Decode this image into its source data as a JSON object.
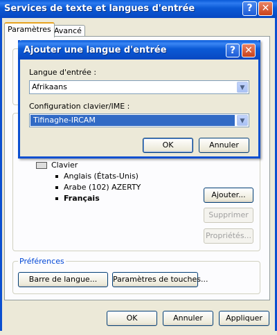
{
  "outer": {
    "title": "Services de texte et langues d'entrée",
    "help_glyph": "?",
    "close_glyph": "✕",
    "tabs": [
      "Paramètres",
      "Avancé"
    ],
    "installed": {
      "keyboard_label": "Clavier",
      "items": [
        "Anglais (États-Unis)",
        "Arabe (102) AZERTY",
        "Français"
      ]
    },
    "buttons": {
      "add": "Ajouter...",
      "remove": "Supprimer",
      "properties": "Propriétés..."
    },
    "preferences": {
      "title": "Préférences",
      "language_bar": "Barre de langue...",
      "key_settings": "Paramètres de touches..."
    },
    "footer": {
      "ok": "OK",
      "cancel": "Annuler",
      "apply": "Appliquer"
    }
  },
  "inner": {
    "title": "Ajouter une langue d'entrée",
    "help_glyph": "?",
    "close_glyph": "✕",
    "input_language_label": "Langue d'entrée :",
    "input_language_value": "Afrikaans",
    "keyboard_label": "Configuration clavier/IME :",
    "keyboard_value": "Tifinaghe-IRCAM",
    "ok": "OK",
    "cancel": "Annuler"
  },
  "colors": {
    "titlebar": "#0b5ad6",
    "selection": "#316ac5",
    "group_title": "#0046d5"
  }
}
